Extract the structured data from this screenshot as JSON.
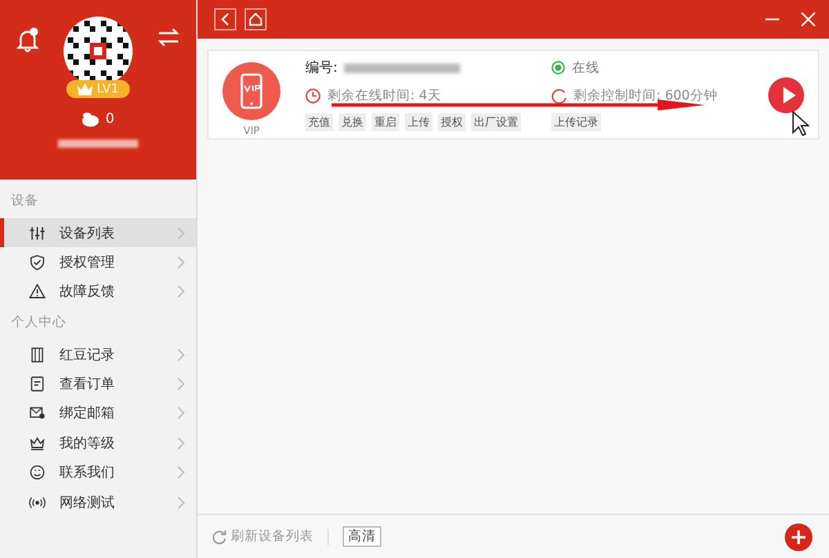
{
  "profile": {
    "level": "LV1",
    "beans": "0"
  },
  "sidebar": {
    "sections": [
      {
        "title": "设备",
        "items": [
          {
            "label": "设备列表",
            "selected": true
          },
          {
            "label": "授权管理",
            "selected": false
          },
          {
            "label": "故障反馈",
            "selected": false
          }
        ]
      },
      {
        "title": "个人中心",
        "items": [
          {
            "label": "红豆记录",
            "selected": false
          },
          {
            "label": "查看订单",
            "selected": false
          },
          {
            "label": "绑定邮箱",
            "selected": false
          },
          {
            "label": "我的等级",
            "selected": false
          },
          {
            "label": "联系我们",
            "selected": false
          },
          {
            "label": "网络测试",
            "selected": false
          }
        ]
      }
    ]
  },
  "device": {
    "badge": "VIP",
    "id_label": "编号:",
    "status": "在线",
    "online_time": "剩余在线时间: 4天",
    "control_time": "剩余控制时间: 600分钟",
    "actions": [
      "充值",
      "兑换",
      "重启",
      "上传",
      "授权",
      "出厂设置"
    ],
    "upload_log": "上传记录"
  },
  "footer": {
    "refresh": "刷新设备列表",
    "quality": "高清"
  }
}
